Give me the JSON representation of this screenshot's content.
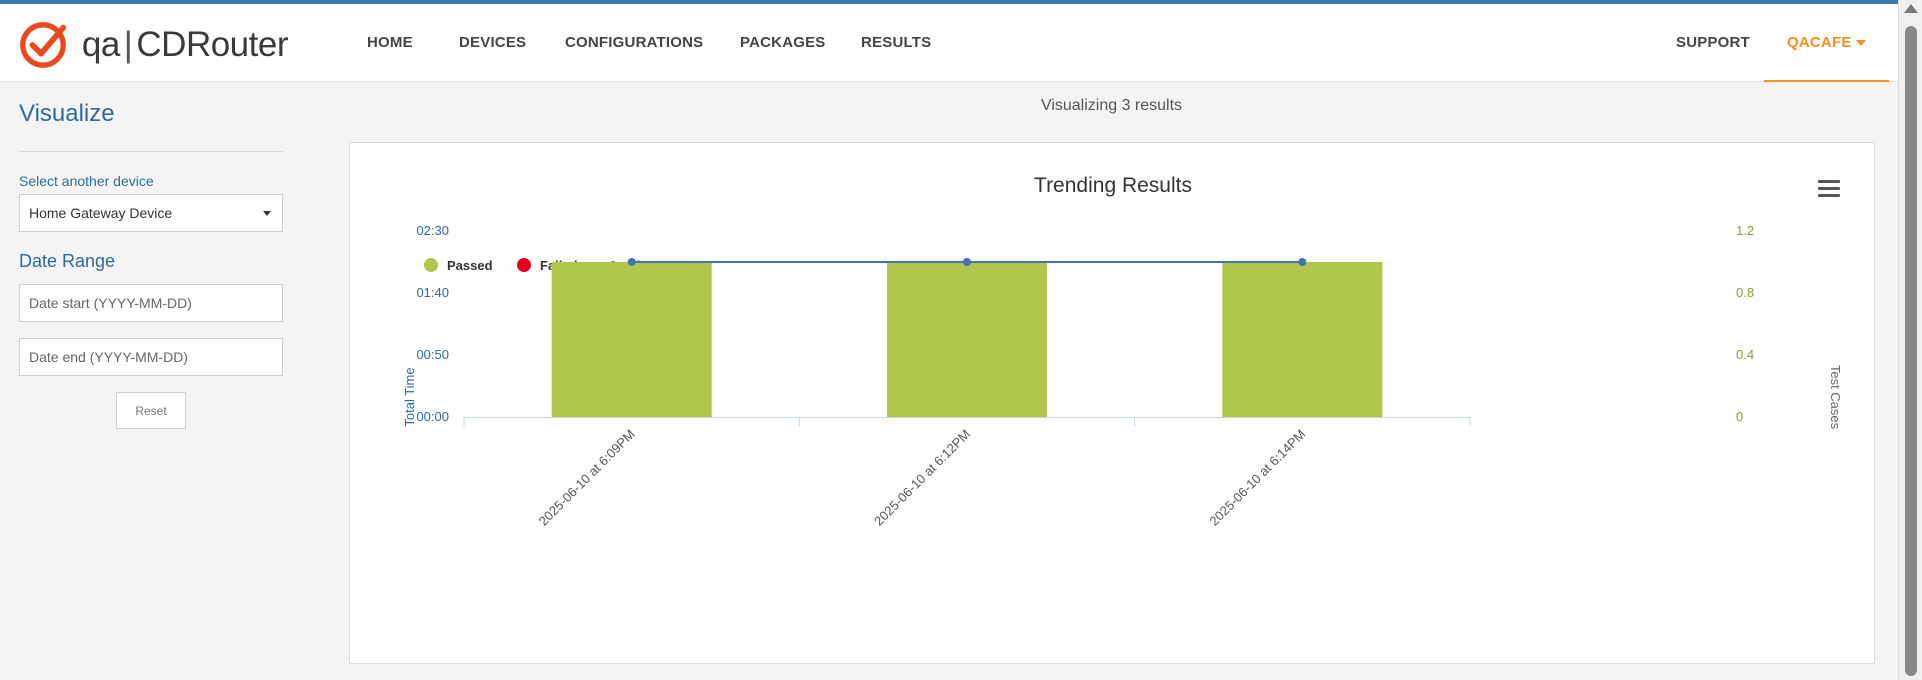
{
  "app": {
    "logo_prefix": "qa",
    "logo_name": "CDRouter"
  },
  "nav": {
    "items": [
      "HOME",
      "DEVICES",
      "CONFIGURATIONS",
      "PACKAGES",
      "RESULTS"
    ],
    "support_label": "SUPPORT",
    "user_label": "QACAFE"
  },
  "sidebar": {
    "title": "Visualize",
    "device_label": "Select another device",
    "device_value": "Home Gateway Device",
    "date_range_title": "Date Range",
    "date_start_placeholder": "Date start (YYYY-MM-DD)",
    "date_end_placeholder": "Date end (YYYY-MM-DD)",
    "reset_label": "Reset"
  },
  "main": {
    "visualizing_text": "Visualizing 3 results"
  },
  "colors": {
    "accent_blue": "#2c6aa0",
    "brand_orange": "#f5921b",
    "passed": "#afc74a",
    "failed": "#e2001a",
    "time": "#4a6fb5"
  },
  "chart_data": {
    "type": "bar",
    "title": "Trending Results",
    "categories": [
      "2025-06-10 at 6:09PM",
      "2025-06-10 at 6:12PM",
      "2025-06-10 at 6:14PM"
    ],
    "series": [
      {
        "name": "Passed",
        "type": "bar",
        "axis": "right",
        "values": [
          1,
          1,
          1
        ],
        "color": "#afc74a"
      },
      {
        "name": "Failed",
        "type": "bar",
        "axis": "right",
        "values": [
          0,
          0,
          0
        ],
        "color": "#e2001a"
      },
      {
        "name": "Time",
        "type": "line",
        "axis": "left",
        "values": [
          "02:05",
          "02:05",
          "02:05"
        ],
        "color": "#4a6fb5"
      }
    ],
    "left_axis": {
      "label": "Total Time",
      "ticks": [
        "00:00",
        "00:50",
        "01:40",
        "02:30"
      ],
      "range_seconds": [
        0,
        150
      ],
      "time_values_seconds": [
        125,
        125,
        125
      ]
    },
    "right_axis": {
      "label": "Test Cases",
      "ticks": [
        "0",
        "0.4",
        "0.8",
        "1.2"
      ],
      "range": [
        0,
        1.2
      ]
    },
    "legend": "top-left",
    "grid": false
  }
}
